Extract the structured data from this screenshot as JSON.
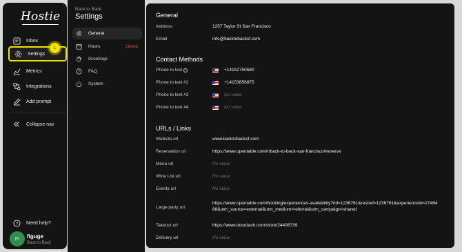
{
  "brand": {
    "logo_text": "Hostie"
  },
  "nav": {
    "items": [
      {
        "label": "Inbox",
        "icon": "inbox-icon"
      },
      {
        "label": "Settings",
        "icon": "gear-icon"
      },
      {
        "label": "Metrics",
        "icon": "chart-icon"
      },
      {
        "label": "Integrations",
        "icon": "integrations-icon"
      },
      {
        "label": "Add prompt",
        "icon": "pencil-icon"
      },
      {
        "label": "Collapse nav",
        "icon": "double-chevron-left-icon"
      }
    ],
    "step_badge": "1",
    "help_label": "Need help?"
  },
  "user": {
    "initials": "FI",
    "name": "figuge",
    "restaurant": "Back to Back"
  },
  "settings_nav": {
    "back_label": "Back to Back",
    "title": "Settings",
    "items": [
      {
        "label": "General",
        "icon": "gear-icon",
        "status": ""
      },
      {
        "label": "Hours",
        "icon": "calendar-icon",
        "status": "Closed"
      },
      {
        "label": "Greetings",
        "icon": "hand-wave-icon",
        "status": ""
      },
      {
        "label": "FAQ",
        "icon": "question-icon",
        "status": ""
      },
      {
        "label": "System",
        "icon": "power-icon",
        "status": ""
      }
    ]
  },
  "general": {
    "title": "General",
    "address_label": "Address",
    "address_value": "1257 Taylor St San Francisco",
    "email_label": "Email",
    "email_value": "info@backtobacksf.com"
  },
  "contact": {
    "title": "Contact Methods",
    "rows": [
      {
        "label": "Phone to text",
        "value": "+14152750580"
      },
      {
        "label": "Phone to text #2",
        "value": "+14153856875"
      },
      {
        "label": "Phone to text #3",
        "value": "No value"
      },
      {
        "label": "Phone to text #4",
        "value": "No value"
      }
    ]
  },
  "urls": {
    "title": "URLs / Links",
    "rows": [
      {
        "label": "Website url",
        "value": "www.backtobacksf.com"
      },
      {
        "label": "Reservation url",
        "value": "https://www.opentable.com/r/back-to-back-san-francisco#reserve"
      },
      {
        "label": "Menu url",
        "value": "No value"
      },
      {
        "label": "Wine List url",
        "value": "No value"
      },
      {
        "label": "Events url",
        "value": "No value"
      },
      {
        "label": "Large party url",
        "value": "https://www.opentable.com/booking/experiences-availability?rid=1236761&restref=1236761&experienceId=2746488&utm_source=external&utm_medium=referral&utm_campaign=shared"
      },
      {
        "label": "Takeout url",
        "value": "https://www.doordash.com/store/24406739"
      },
      {
        "label": "Delivery url",
        "value": "No value"
      }
    ]
  }
}
